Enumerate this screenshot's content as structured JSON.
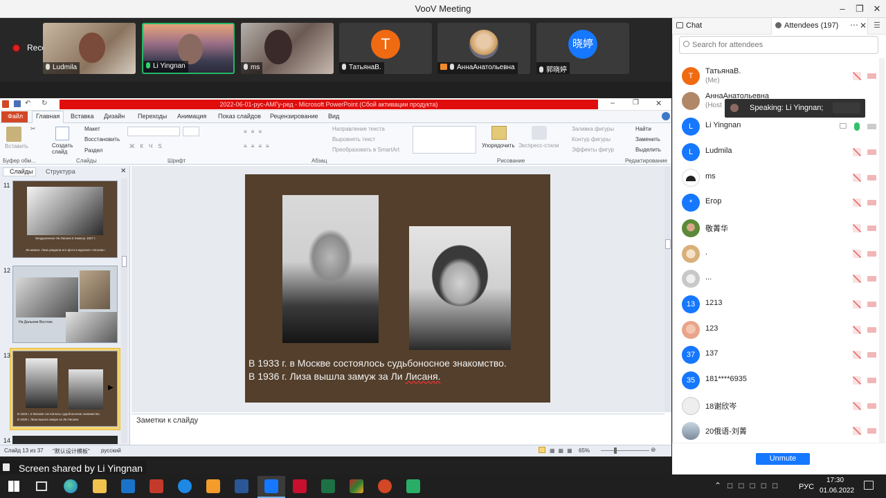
{
  "window": {
    "title": "VooV Meeting"
  },
  "meeting": {
    "recording_label": "Recording",
    "participants": [
      {
        "name": "Ludmila",
        "type": "video"
      },
      {
        "name": "Li Yingnan",
        "type": "video",
        "active": true
      },
      {
        "name": "ms",
        "type": "video"
      },
      {
        "name": "ТатьянаВ.",
        "type": "avatar",
        "initial": "T",
        "color": "#f06a12"
      },
      {
        "name": "АннаАнатольевна",
        "type": "photo"
      },
      {
        "name": "郭晓婷",
        "type": "avatar",
        "initial": "晓婷",
        "color": "#1677ff"
      }
    ],
    "share_label": "Screen shared by Li Yingnan"
  },
  "ppt": {
    "doc_title": "2022-06-01-рус-АМГу-ред - Microsoft PowerPoint (Сбой активации продукта)",
    "tabs": [
      "Файл",
      "Главная",
      "Вставка",
      "Дизайн",
      "Переходы",
      "Анимация",
      "Показ слайдов",
      "Рецензирование",
      "Вид"
    ],
    "ribbon": {
      "paste": "Вставить",
      "create_slide": "Создать слайд",
      "layout": "Макет",
      "restore": "Восстановить",
      "section": "Раздел",
      "text_direction": "Направление текста",
      "align_text": "Выровнять текст",
      "smartart": "Преобразовать в SmartArt",
      "arrange": "Упорядочить",
      "express_styles": "Экспресс-стили",
      "shape_fill": "Заливка фигуры",
      "shape_outline": "Контур фигуры",
      "shape_effects": "Эффекты фигур",
      "find": "Найти",
      "replace": "Заменить",
      "select": "Выделить",
      "groups": {
        "clipboard": "Буфер обм...",
        "slides": "Слайды",
        "font": "Шрифт",
        "paragraph": "Абзац",
        "drawing": "Рисование",
        "editing": "Редактирование"
      }
    },
    "panel_tabs": [
      "Слайды",
      "Структура"
    ],
    "thumbnails": [
      {
        "num": "11",
        "caption": "Бездушенное Ли Лисаня в Хемкоу. 1927 г.",
        "caption2": "Ли можно. Лиза увидела его фото в журнале «Огонек»."
      },
      {
        "num": "12",
        "caption": "На Дальнем Востоке."
      },
      {
        "num": "13",
        "caption": "В 1933 г. в Москве состоялось судьбоносное знакомство.",
        "caption2": "В 1936 г. Лиза вышла замуж за Ли Лисаня."
      },
      {
        "num": "14"
      }
    ],
    "slide": {
      "line1": "В 1933 г. в Москве состоялось судьбоносное знакомство.",
      "line2_a": "В 1936 г. Лиза вышла замуж за Ли ",
      "line2_b": "Лисаня."
    },
    "notes_placeholder": "Заметки к слайду",
    "status": {
      "slide_of": "Слайд 13 из 37",
      "theme": "\"默认设计模板\"",
      "language": "русский",
      "zoom": "65%"
    }
  },
  "sidebar": {
    "tab_chat": "Chat",
    "tab_attendees": "Attendees (197)",
    "search_placeholder": "Search for attendees",
    "speaking": "Speaking: Li Yingnan;",
    "attendees": [
      {
        "name": "ТатьянаВ.",
        "sub": "(Me)",
        "initial": "T",
        "color": "#f06a12"
      },
      {
        "name": "АннаАнатольевна",
        "sub": "(Host",
        "initial": "",
        "color": "#b08868"
      },
      {
        "name": "Li Yingnan",
        "initial": "L",
        "color": "#1677ff",
        "mic_on": true
      },
      {
        "name": "Ludmila",
        "initial": "L",
        "color": "#1677ff"
      },
      {
        "name": "ms",
        "initial": "",
        "color": "#333333"
      },
      {
        "name": "Егор",
        "initial": "*",
        "color": "#1677ff"
      },
      {
        "name": "敬菁华",
        "initial": "",
        "color": "#5a8a3a"
      },
      {
        "name": ".",
        "initial": "",
        "color": "#d9b07a"
      },
      {
        "name": "...",
        "initial": "",
        "color": "#c8c8c8"
      },
      {
        "name": "1213",
        "initial": "13",
        "color": "#1677ff"
      },
      {
        "name": "123",
        "initial": "",
        "color": "#e9a48b"
      },
      {
        "name": "137",
        "initial": "37",
        "color": "#1677ff"
      },
      {
        "name": "181****6935",
        "initial": "35",
        "color": "#1677ff"
      },
      {
        "name": "18谢欣岑",
        "initial": "",
        "color": "#eeeeee"
      },
      {
        "name": "20俄语-刘菁",
        "initial": "",
        "color": "#7a8a9a"
      }
    ],
    "unmute": "Unmute"
  },
  "taskbar": {
    "lang": "РУС",
    "time": "17:30",
    "date": "01.06.2022"
  }
}
